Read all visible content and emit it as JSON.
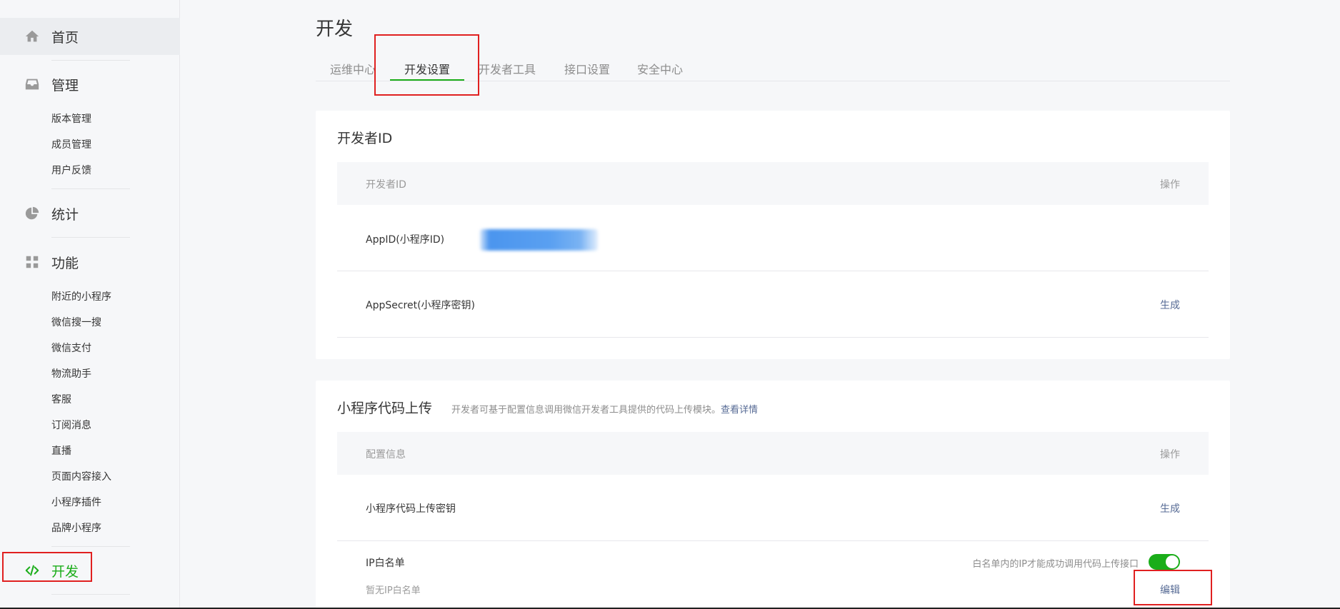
{
  "sidebar": {
    "home": "首页",
    "manage": {
      "label": "管理",
      "items": [
        "版本管理",
        "成员管理",
        "用户反馈"
      ]
    },
    "stats": "统计",
    "features": {
      "label": "功能",
      "items": [
        "附近的小程序",
        "微信搜一搜",
        "微信支付",
        "物流助手",
        "客服",
        "订阅消息",
        "直播",
        "页面内容接入",
        "小程序插件",
        "品牌小程序"
      ]
    },
    "dev": "开发"
  },
  "page": {
    "title": "开发",
    "tabs": [
      "运维中心",
      "开发设置",
      "开发者工具",
      "接口设置",
      "安全中心"
    ],
    "active_tab": "开发设置"
  },
  "developer_id_card": {
    "title": "开发者ID",
    "header": {
      "col1": "开发者ID",
      "col2": "操作"
    },
    "rows": [
      {
        "label": "AppID(小程序ID)",
        "action": ""
      },
      {
        "label": "AppSecret(小程序密钥)",
        "action": "生成"
      }
    ]
  },
  "upload_card": {
    "title": "小程序代码上传",
    "desc": "开发者可基于配置信息调用微信开发者工具提供的代码上传模块。",
    "desc_link": "查看详情",
    "header": {
      "col1": "配置信息",
      "col2": "操作"
    },
    "rows": [
      {
        "label": "小程序代码上传密钥",
        "action": "生成"
      },
      {
        "label": "IP白名单",
        "sub": "暂无IP白名单",
        "hint": "白名单内的IP才能成功调用代码上传接口",
        "action": "编辑",
        "toggle_on": true
      }
    ]
  },
  "colors": {
    "accent_green": "#1aad19",
    "link_blue": "#576b95",
    "highlight_red": "#e02020"
  }
}
